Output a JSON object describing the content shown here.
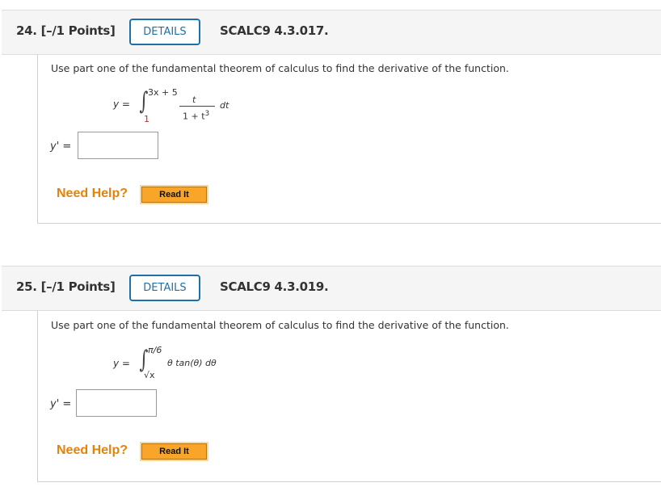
{
  "questions": [
    {
      "number": "24.",
      "points": "[–/1 Points]",
      "details_label": "DETAILS",
      "code": "SCALC9 4.3.017.",
      "prompt": "Use part one of the fundamental theorem of calculus to find the derivative of the function.",
      "function": {
        "lhs": "y =",
        "upper_limit": "3x + 5",
        "lower_limit": "1",
        "numerator": "t",
        "denominator": "1 + t",
        "denominator_exp": "3",
        "differential": "dt"
      },
      "answer_label": "y' =",
      "answer_value": "",
      "need_help": "Need Help?",
      "read_it": "Read It"
    },
    {
      "number": "25.",
      "points": "[–/1 Points]",
      "details_label": "DETAILS",
      "code": "SCALC9 4.3.019.",
      "prompt": "Use part one of the fundamental theorem of calculus to find the derivative of the function.",
      "function": {
        "lhs": "y =",
        "upper_limit": "π/6",
        "lower_limit": "√x",
        "integrand": "θ tan(θ) dθ"
      },
      "answer_label": "y' =",
      "answer_value": "",
      "need_help": "Need Help?",
      "read_it": "Read It"
    }
  ]
}
